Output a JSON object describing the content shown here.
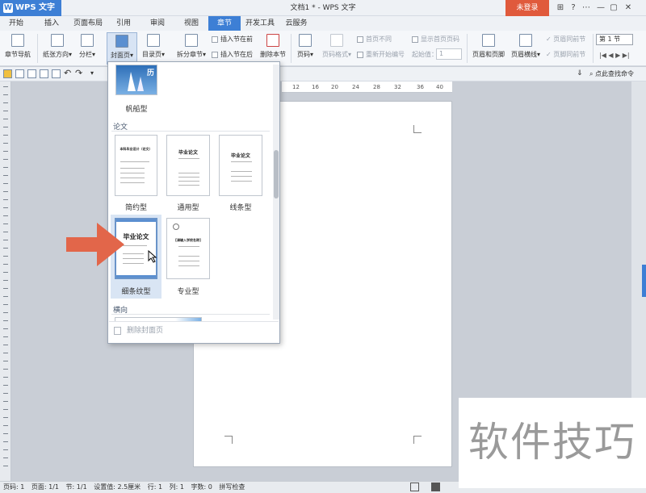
{
  "titlebar": {
    "app_name": "WPS 文字",
    "doc_title": "文档1 * - WPS 文字",
    "login": "未登录",
    "help": "?",
    "minimize": "—",
    "restore": "▢",
    "close": "✕"
  },
  "menu_tabs": [
    "开始",
    "插入",
    "页面布局",
    "引用",
    "审阅",
    "视图",
    "章节",
    "开发工具",
    "云服务"
  ],
  "active_tab": "章节",
  "ribbon": {
    "nav": "章节导航",
    "orientation": "纸张方向",
    "columns": "分栏",
    "cover": "封面页",
    "toc": "目录页",
    "split": "拆分章节",
    "insert_before": "插入节在前",
    "insert_after": "插入节在后",
    "delete_section": "删除本节",
    "page_num": "页码",
    "page_num_format": "页码格式",
    "first_page_diff": "首页不同",
    "show_first_num": "显示首页页码",
    "restart_num": "重新开始编号",
    "start_value": "起始值：",
    "start_value_num": "1",
    "header_footer": "页眉和页脚",
    "header_line": "页眉横线",
    "header_same": "页眉同前节",
    "footer_same": "页脚同前节",
    "section_field": "第 1 节"
  },
  "find_command": "点此查找命令",
  "ruler_numbers": [
    "12",
    "16",
    "20",
    "24",
    "28",
    "32",
    "36",
    "40"
  ],
  "gallery": {
    "prev_item": "帆船型",
    "prev_thumb_text": "历",
    "section_thesis": "论文",
    "items": [
      {
        "label": "简约型",
        "title": "本科毕业设计（论文）"
      },
      {
        "label": "通用型",
        "title": "毕业论文"
      },
      {
        "label": "线条型",
        "title": "毕业论文"
      },
      {
        "label": "细条纹型",
        "title": "毕业论文"
      },
      {
        "label": "专业型",
        "title": "[请输入学校名称]"
      }
    ],
    "section_landscape": "横向",
    "delete_cover": "删除封面页"
  },
  "statusbar": {
    "page_num": "页码: 1",
    "pages": "页面: 1/1",
    "section": "节: 1/1",
    "setting": "设置值: 2.5厘米",
    "row": "行: 1",
    "col": "列: 1",
    "words": "字数: 0",
    "spell": "拼写检查"
  },
  "watermark": "软件技巧",
  "colors": {
    "accent": "#3d7fd5",
    "login": "#e05a3c",
    "arrow": "#e2664a"
  }
}
